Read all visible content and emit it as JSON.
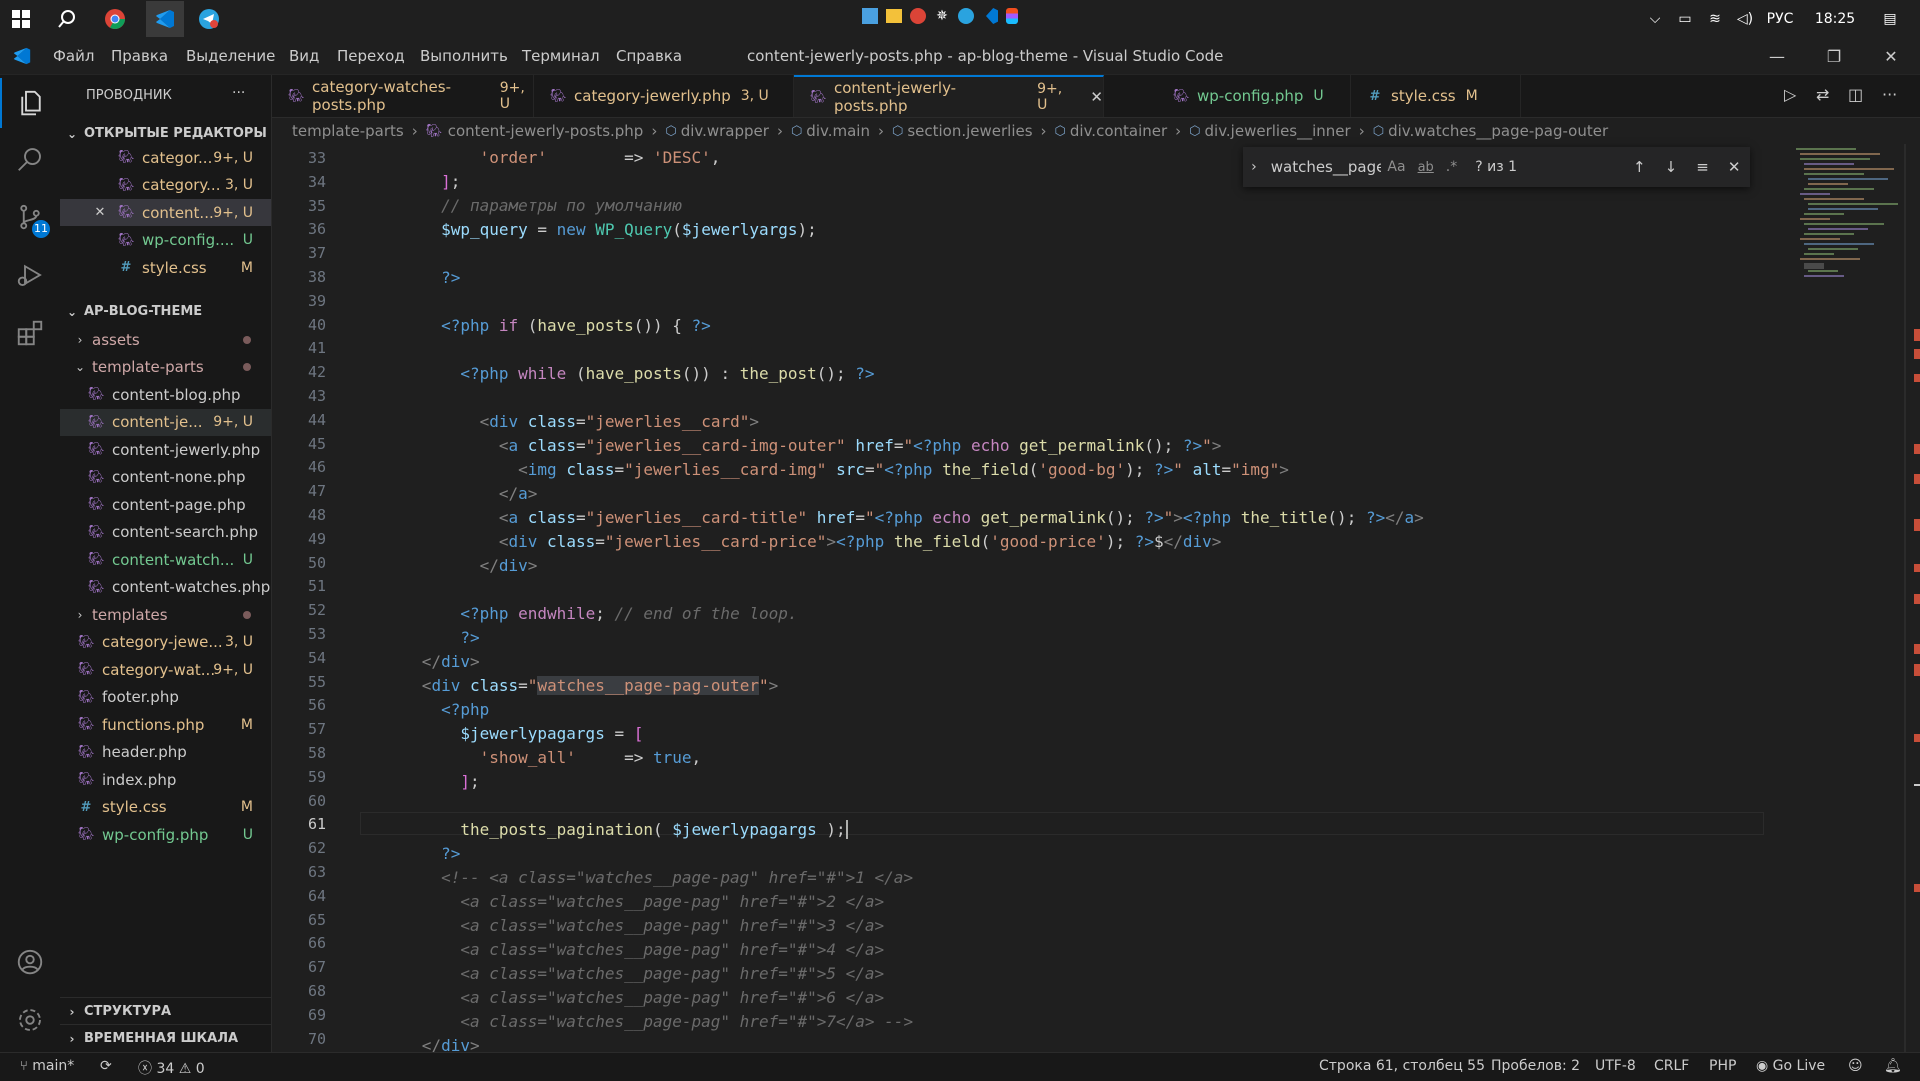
{
  "taskbar": {
    "language": "РУС",
    "time": "18:25",
    "icons": [
      "windows-start-icon",
      "search-icon",
      "chrome-icon",
      "vscode-icon",
      "telegram-icon"
    ],
    "tray_apps": [
      "desktop-icon",
      "folder-icon",
      "chrome-icon",
      "settings-icon",
      "telegram-icon",
      "vscode-icon",
      "figma-icon"
    ]
  },
  "menu": {
    "items": [
      "Файл",
      "Правка",
      "Выделение",
      "Вид",
      "Переход",
      "Выполнить",
      "Терминал",
      "Справка"
    ],
    "window_title": "content-jewerly-posts.php - ap-blog-theme - Visual Studio Code"
  },
  "activitybar": {
    "scm_badge": "11"
  },
  "sidebar": {
    "title": "ПРОВОДНИК",
    "more": "···",
    "open_editors_label": "ОТКРЫТЫЕ РЕДАКТОРЫ",
    "open_editors": [
      {
        "name": "categor...",
        "badge": "9+, U",
        "type": "php",
        "close": ""
      },
      {
        "name": "category...",
        "badge": "3, U",
        "type": "php",
        "close": ""
      },
      {
        "name": "content...",
        "badge": "9+, U",
        "type": "php",
        "close": "✕"
      },
      {
        "name": "wp-config....",
        "badge": "U",
        "type": "php",
        "close": ""
      },
      {
        "name": "style.css",
        "badge": "M",
        "type": "css",
        "close": ""
      }
    ],
    "project_label": "AP-BLOG-THEME",
    "tree": [
      {
        "name": "assets",
        "badge": "",
        "type": "folder",
        "indent": 1,
        "chevron": "›",
        "dot": true
      },
      {
        "name": "template-parts",
        "badge": "",
        "type": "folder",
        "indent": 1,
        "chevron": "⌄",
        "dot": true
      },
      {
        "name": "content-blog.php",
        "badge": "",
        "type": "php",
        "indent": 2
      },
      {
        "name": "content-je...",
        "badge": "9+, U",
        "type": "php",
        "indent": 2
      },
      {
        "name": "content-jewerly.php",
        "badge": "",
        "type": "php",
        "indent": 2
      },
      {
        "name": "content-none.php",
        "badge": "",
        "type": "php",
        "indent": 2
      },
      {
        "name": "content-page.php",
        "badge": "",
        "type": "php",
        "indent": 2
      },
      {
        "name": "content-search.php",
        "badge": "",
        "type": "php",
        "indent": 2
      },
      {
        "name": "content-watch...",
        "badge": "U",
        "type": "php",
        "indent": 2
      },
      {
        "name": "content-watches.php",
        "badge": "",
        "type": "php",
        "indent": 2
      },
      {
        "name": "templates",
        "badge": "",
        "type": "folder",
        "indent": 1,
        "chevron": "›",
        "dot": true
      },
      {
        "name": "category-jewe...",
        "badge": "3, U",
        "type": "php",
        "indent": 1
      },
      {
        "name": "category-wat...",
        "badge": "9+, U",
        "type": "php",
        "indent": 1
      },
      {
        "name": "footer.php",
        "badge": "",
        "type": "php",
        "indent": 1
      },
      {
        "name": "functions.php",
        "badge": "M",
        "type": "php",
        "indent": 1
      },
      {
        "name": "header.php",
        "badge": "",
        "type": "php",
        "indent": 1
      },
      {
        "name": "index.php",
        "badge": "",
        "type": "php",
        "indent": 1
      },
      {
        "name": "style.css",
        "badge": "M",
        "type": "css",
        "indent": 1
      },
      {
        "name": "wp-config.php",
        "badge": "U",
        "type": "php",
        "indent": 1
      }
    ],
    "outline_label": "СТРУКТУРА",
    "timeline_label": "ВРЕМЕННАЯ ШКАЛА"
  },
  "tabs": [
    {
      "name": "category-watches-posts.php",
      "badge": "9+, U",
      "type": "php",
      "active": false
    },
    {
      "name": "category-jewerly.php",
      "badge": "3, U",
      "type": "php",
      "active": false
    },
    {
      "name": "content-jewerly-posts.php",
      "badge": "9+, U",
      "type": "php",
      "active": true
    },
    {
      "name": "wp-config.php",
      "badge": "U",
      "type": "php",
      "active": false
    },
    {
      "name": "style.css",
      "badge": "M",
      "type": "css",
      "active": false
    }
  ],
  "breadcrumb": [
    "template-parts",
    "content-jewerly-posts.php",
    "div.wrapper",
    "div.main",
    "section.jewerlies",
    "div.container",
    "div.jewerlies__inner",
    "div.watches__page-pag-outer"
  ],
  "find": {
    "query": "watches__page-",
    "opt_case": "Aa",
    "opt_word": "ab",
    "opt_regex": ".*",
    "result": "? из 1"
  },
  "editor": {
    "current_line": "61",
    "line_numbers": [
      "33",
      "34",
      "35",
      "36",
      "37",
      "38",
      "39",
      "40",
      "41",
      "42",
      "43",
      "44",
      "45",
      "46",
      "47",
      "48",
      "49",
      "50",
      "51",
      "52",
      "53",
      "54",
      "55",
      "56",
      "57",
      "58",
      "59",
      "60",
      "61",
      "62",
      "63",
      "64",
      "65",
      "66",
      "67",
      "68",
      "69",
      "70"
    ]
  },
  "statusbar": {
    "branch": "main*",
    "errors": "34",
    "warnings": "0",
    "position": "Строка 61, столбец 55",
    "spaces": "Пробелов: 2",
    "encoding": "UTF-8",
    "eol": "CRLF",
    "language": "PHP",
    "golive": "Go Live"
  }
}
